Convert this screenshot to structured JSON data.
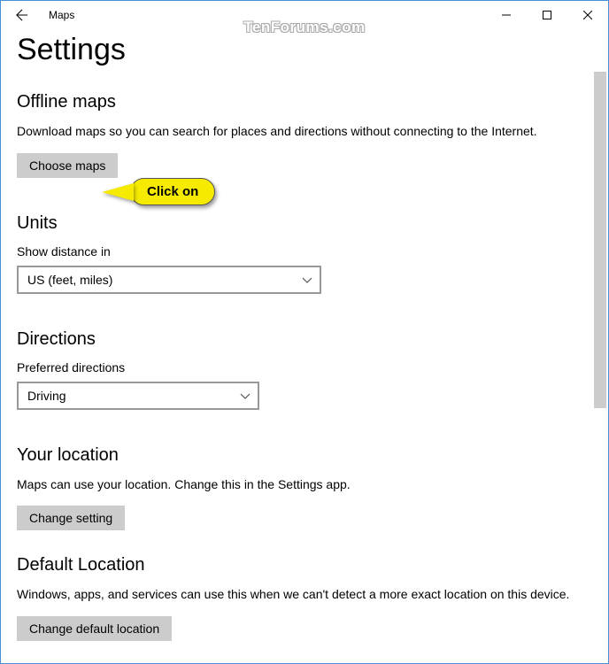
{
  "titlebar": {
    "app_name": "Maps"
  },
  "page": {
    "heading": "Settings"
  },
  "watermark": "TenForums.com",
  "callout": {
    "text": "Click on"
  },
  "sections": {
    "offline_maps": {
      "heading": "Offline maps",
      "desc": "Download maps so you can search for places and directions without connecting to the Internet.",
      "button_label": "Choose maps"
    },
    "units": {
      "heading": "Units",
      "label": "Show distance in",
      "selected": "US (feet, miles)"
    },
    "directions": {
      "heading": "Directions",
      "label": "Preferred directions",
      "selected": "Driving"
    },
    "your_location": {
      "heading": "Your location",
      "desc": "Maps can use your location. Change this in the Settings app.",
      "button_label": "Change setting"
    },
    "default_location": {
      "heading": "Default Location",
      "desc": "Windows, apps, and services can use this when we can't detect a more exact location on this device.",
      "button_label": "Change default location"
    }
  }
}
